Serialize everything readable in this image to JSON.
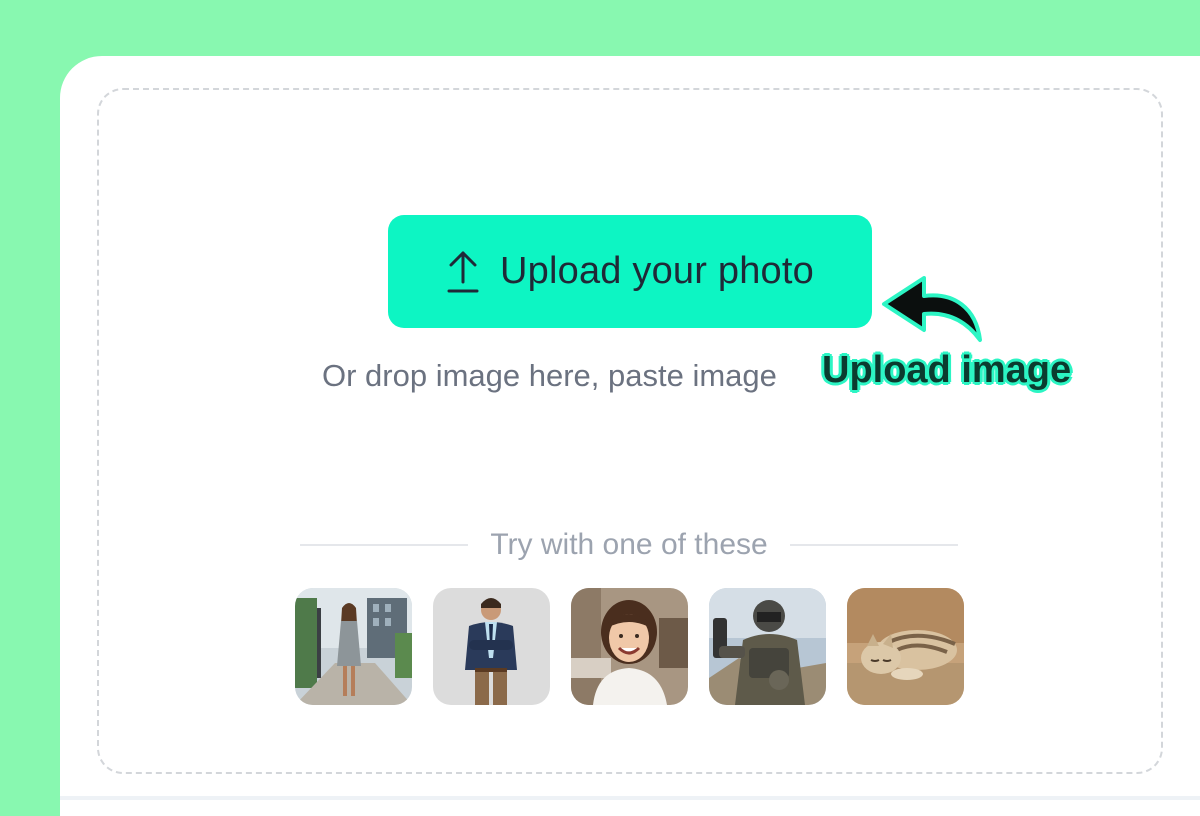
{
  "upload": {
    "button_label": "Upload your photo",
    "icon": "upload-arrow-icon",
    "hint": "Or drop image here, paste image"
  },
  "annotation": {
    "text": "Upload image",
    "icon": "curved-arrow-left-icon"
  },
  "samples": {
    "heading": "Try with one of these",
    "items": [
      {
        "icon": "woman-walking-street-photo"
      },
      {
        "icon": "man-in-suit-photo"
      },
      {
        "icon": "smiling-girl-photo"
      },
      {
        "icon": "armored-soldier-photo"
      },
      {
        "icon": "sleeping-cat-photo"
      }
    ]
  },
  "colors": {
    "background": "#88f8b0",
    "accent": "#0df5c3",
    "card": "#ffffff"
  }
}
